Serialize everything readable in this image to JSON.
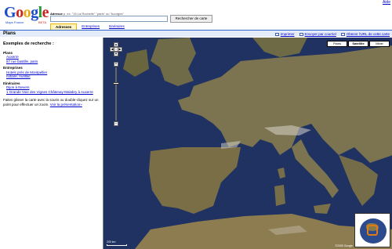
{
  "header": {
    "help_link": "Aide",
    "logo_text": "Google",
    "logo_sub": "Maps France",
    "logo_beta": "BETA",
    "address_label": "Adresse",
    "address_hint": " p. ex. \"15 La Rochelle\" \"paris\" ou \"bourges\"",
    "search_value": "",
    "search_button": "Rechercher de carte"
  },
  "tabs": [
    {
      "label": "Adresses",
      "active": true
    },
    {
      "label": "Entreprises",
      "active": false
    },
    {
      "label": "Itinéraires",
      "active": false
    }
  ],
  "titlebar": {
    "title": "Plans",
    "print": "Imprimer",
    "email": "Envoyer par courriel",
    "link": "Obtenir l'URL de cette carte"
  },
  "sidebar": {
    "title": "Exemples de recherche :",
    "plans_head": "Plans",
    "plans_items": [
      "Auxerre",
      "87 rue bastille, paris"
    ],
    "ent_head": "Entreprises",
    "ent_items": [
      "Hotels près de Montpellier",
      "notaire, Aurillac"
    ],
    "itin_head": "Itinéraires",
    "itin_items": [
      "Dijon à Nevers",
      "1 Grande Voie des Vignes Châtenay-Malabry à Auxerre"
    ],
    "note": "Faites glisser la carte avec la souris ou double-cliquez sur un point pour effectuer un zoom.",
    "note_link": "Voir la présentation»"
  },
  "map": {
    "type_buttons": [
      "Plans",
      "Satellite",
      "Mixte"
    ],
    "selected_type": "Satellite",
    "zoom_level_fraction": 0.3,
    "scale_text": "200 km",
    "copyright": "©2005 Google",
    "colors": {
      "sea": "#203262",
      "land": "#7c7450",
      "land_dark": "#5f5a3a",
      "snow": "#d8d6cc"
    }
  }
}
